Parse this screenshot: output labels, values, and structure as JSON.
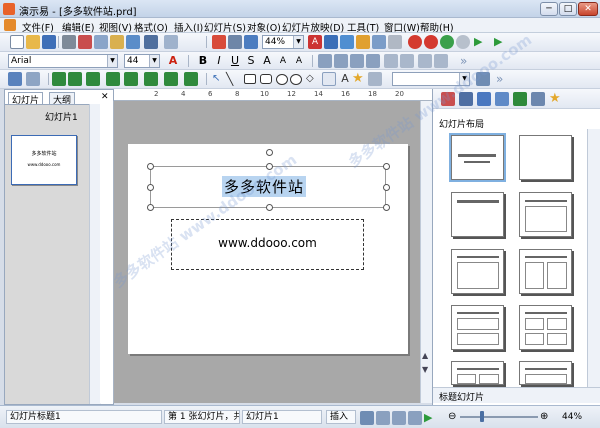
{
  "window": {
    "title": "演示易 - [多多软件站.prd]",
    "buttons": [
      "─",
      "□",
      "✕"
    ],
    "close_color": "#c8452d"
  },
  "menu": [
    "文件(F)",
    "编辑(E)",
    "视图(V)",
    "格式(O)",
    "插入(I)",
    "幻灯片(S)",
    "对象(O)",
    "幻灯片放映(D)",
    "工具(T)",
    "窗口(W)",
    "帮助(H)"
  ],
  "toolbar1": {
    "zoom": "44%"
  },
  "toolbar2": {
    "font_name": "Arial",
    "font_size": "44",
    "font_color_glyph": "A"
  },
  "left_panel": {
    "tabs": [
      "幻灯片",
      "大纲"
    ],
    "thumb_label": "幻灯片1",
    "thumb_title": "多多软件站",
    "thumb_sub": "www.ddooo.com"
  },
  "ruler": {
    "numbers": [
      "2",
      "4",
      "6",
      "8",
      "10",
      "12",
      "14",
      "16",
      "18",
      "20"
    ]
  },
  "slide": {
    "title": "多多软件站",
    "subtitle": "www.ddooo.com"
  },
  "right_panel": {
    "heading": "幻灯片布局",
    "bottom_label": "标题幻灯片",
    "layouts": [
      "title-slide",
      "blank",
      "title-only",
      "title-content",
      "title-two-content",
      "comparison",
      "content-grid",
      "title-table",
      "title-two-table",
      "title-content-caption"
    ]
  },
  "status": {
    "layout_name": "幻灯片标题1",
    "position": "第 1 张幻灯片，共",
    "slide_name": "幻灯片1",
    "mode": "插入",
    "zoom": "44%",
    "zoom_level": 0.44
  },
  "watermark": "多多软件站 www.ddooo.com",
  "colors": {
    "accent_selection": "#b8d4f0",
    "toolbar_bg": "#e2e8f2",
    "title_bar": "#c3d3e8"
  }
}
